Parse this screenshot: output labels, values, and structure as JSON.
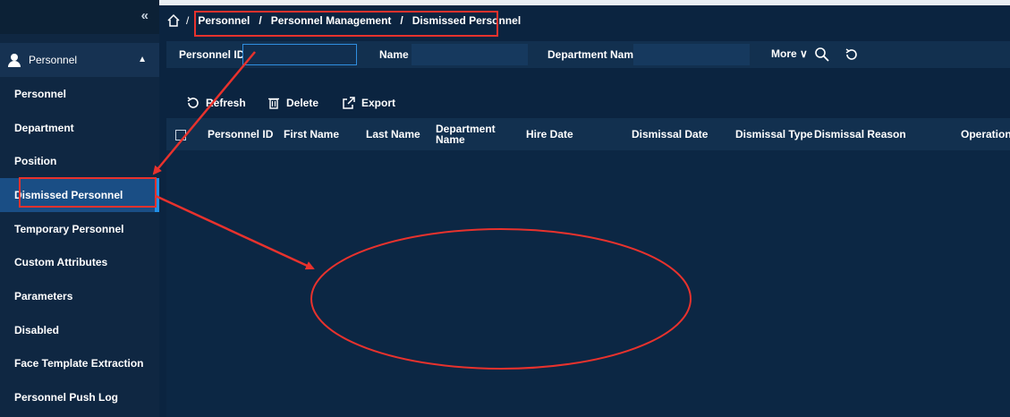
{
  "sidebar": {
    "collapse_glyph": "«",
    "section": {
      "label": "Personnel",
      "caret": "▲"
    },
    "items": [
      {
        "label": "Personnel"
      },
      {
        "label": "Department"
      },
      {
        "label": "Position"
      },
      {
        "label": "Dismissed Personnel",
        "active": true
      },
      {
        "label": "Temporary Personnel"
      },
      {
        "label": "Custom Attributes"
      },
      {
        "label": "Parameters"
      },
      {
        "label": "Disabled"
      },
      {
        "label": "Face Template Extraction"
      },
      {
        "label": "Personnel Push Log"
      }
    ]
  },
  "breadcrumb": {
    "root_sep": "/",
    "items": [
      "Personnel",
      "Personnel Management",
      "Dismissed Personnel"
    ],
    "separator": "/"
  },
  "filter": {
    "personnel_id_label": "Personnel ID",
    "personnel_id_value": "",
    "name_label": "Name",
    "name_value": "",
    "department_label": "Department Name",
    "department_value": "",
    "more_label": "More",
    "more_glyph": "∨"
  },
  "toolbar": {
    "refresh_label": "Refresh",
    "delete_label": "Delete",
    "export_label": "Export"
  },
  "table": {
    "columns": [
      "Personnel ID",
      "First Name",
      "Last Name",
      "Department Name",
      "Hire Date",
      "Dismissal Date",
      "Dismissal Type",
      "Dismissal Reason",
      "Operations"
    ],
    "rows": []
  },
  "colors": {
    "background": "#0b2440",
    "sidebar": "#0f2742",
    "active_item": "#1a4e85",
    "accent": "#1f8fe6",
    "annotation": "#e8322d"
  }
}
